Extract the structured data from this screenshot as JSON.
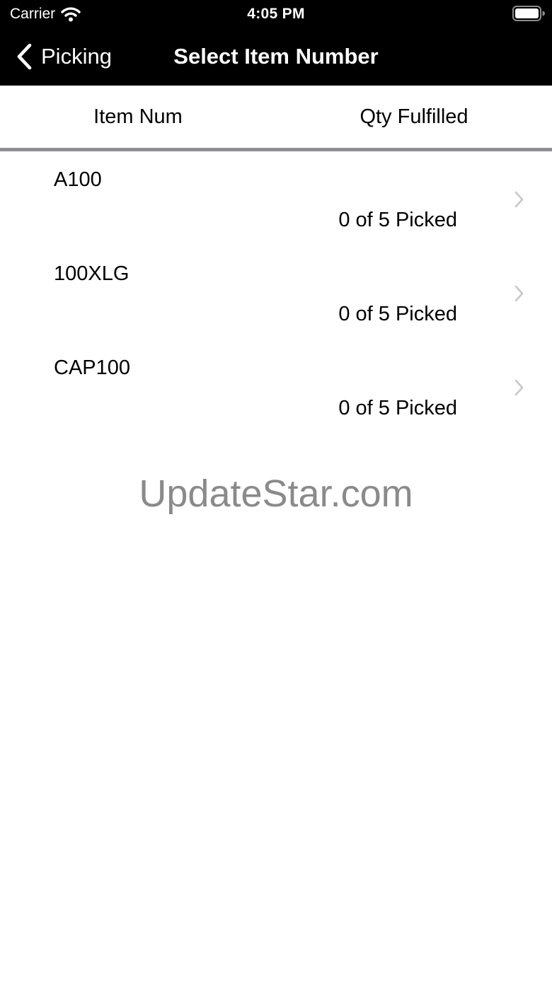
{
  "status_bar": {
    "carrier": "Carrier",
    "time": "4:05 PM",
    "icons": [
      "wifi-icon",
      "battery-icon"
    ]
  },
  "nav_bar": {
    "back_label": "Picking",
    "back_icon": "chevron-left-icon",
    "title": "Select Item Number"
  },
  "table": {
    "headers": {
      "item_num": "Item Num",
      "qty_fulfilled": "Qty Fulfilled"
    },
    "rows": [
      {
        "item_num": "A100",
        "qty": "0 of 5 Picked",
        "icon": "chevron-right-icon"
      },
      {
        "item_num": "100XLG",
        "qty": "0 of 5 Picked",
        "icon": "chevron-right-icon"
      },
      {
        "item_num": "CAP100",
        "qty": "0 of 5 Picked",
        "icon": "chevron-right-icon"
      }
    ]
  },
  "watermark": "UpdateStar.com",
  "colors": {
    "bar_background": "#000000",
    "bar_text": "#ffffff",
    "header_rule": "#8e8e93",
    "chevron": "#c7c7cc",
    "watermark": "#8a8a8a"
  }
}
